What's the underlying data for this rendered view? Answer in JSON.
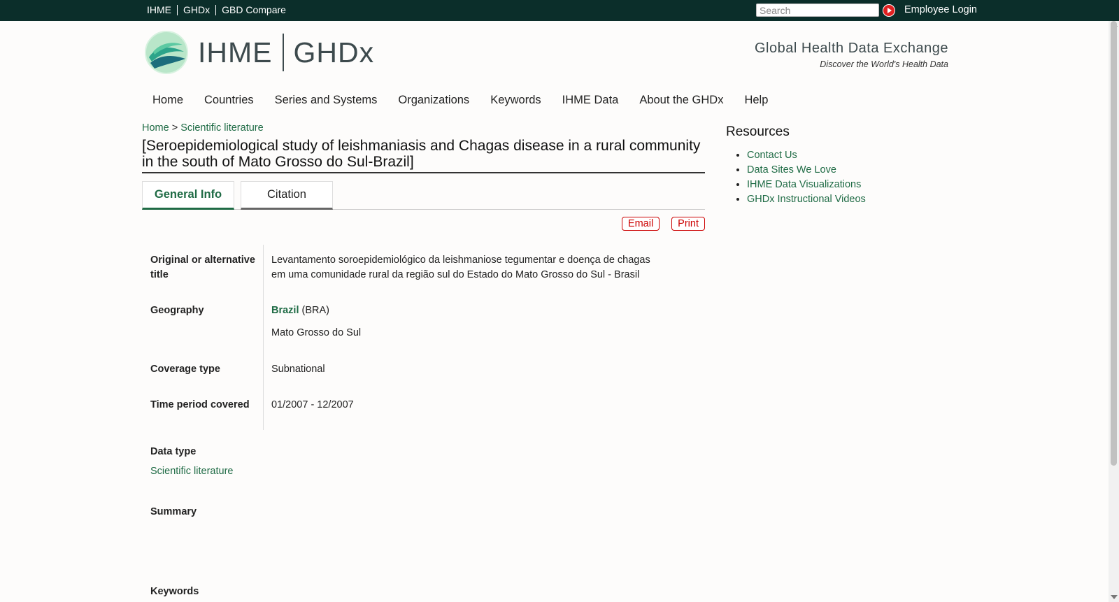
{
  "topbar": {
    "links": [
      "IHME",
      "GHDx",
      "GBD Compare"
    ],
    "search_placeholder": "Search",
    "login": "Employee Login"
  },
  "header": {
    "org": "IHME",
    "product": "GHDx",
    "tagline_title": "Global Health Data Exchange",
    "tagline_sub": "Discover the World's Health Data"
  },
  "nav": [
    "Home",
    "Countries",
    "Series and Systems",
    "Organizations",
    "Keywords",
    "IHME Data",
    "About the GHDx",
    "Help"
  ],
  "breadcrumb": {
    "home": "Home",
    "sep": ">",
    "section": "Scientific literature"
  },
  "page_title": "[Seroepidemiological study of leishmaniasis and Chagas disease in a rural community in the south of Mato Grosso do Sul-Brazil]",
  "tabs": {
    "general": "General Info",
    "citation": "Citation"
  },
  "actions": {
    "email": "Email",
    "print": "Print"
  },
  "details": {
    "alt_title_label": "Original or alternative title",
    "alt_title_value": "Levantamento soroepidemiológico da leishmaniose tegumentar e doença de chagas em uma comunidade rural da região sul do Estado do Mato Grosso do Sul - Brasil",
    "geography_label": "Geography",
    "geography_country": "Brazil",
    "geography_code": "(BRA)",
    "geography_region": "Mato Grosso do Sul",
    "coverage_label": "Coverage type",
    "coverage_value": "Subnational",
    "time_label": "Time period covered",
    "time_value": "01/2007 - 12/2007"
  },
  "data_type": {
    "label": "Data type",
    "value": "Scientific literature"
  },
  "summary_label": "Summary",
  "keywords_label": "Keywords",
  "sidebar": {
    "title": "Resources",
    "links": [
      "Contact Us",
      "Data Sites We Love",
      "IHME Data Visualizations",
      "GHDx Instructional Videos"
    ]
  },
  "colors": {
    "topbar": "#0b2e2a",
    "link": "#1f6b45",
    "action": "#cc0000"
  }
}
